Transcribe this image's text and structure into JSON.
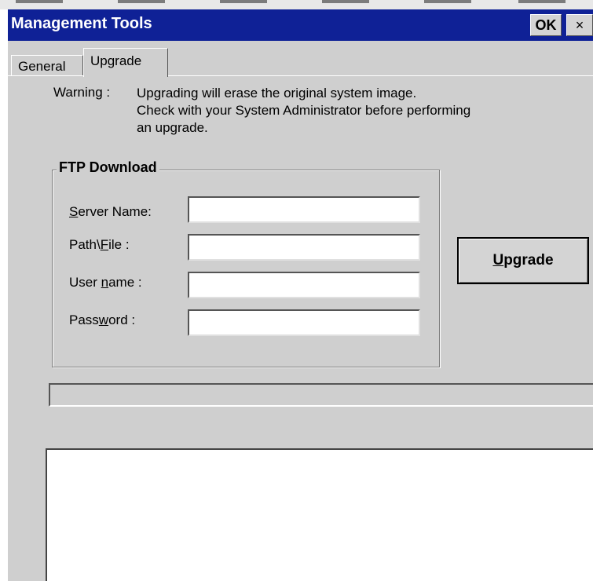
{
  "window": {
    "title": "Management Tools",
    "ok_label": "OK",
    "close_label": "×",
    "title_bar_color": "#0f2196",
    "background_color": "#cfcfcf"
  },
  "tabs": [
    {
      "label": "General",
      "active": false
    },
    {
      "label": "Upgrade",
      "active": true
    }
  ],
  "warning": {
    "label": "Warning :",
    "lines": [
      "Upgrading will erase the original system image.",
      "Check with your System Administrator before performing",
      "an upgrade."
    ]
  },
  "ftp": {
    "group_label": "FTP Download",
    "fields": [
      {
        "label_pre": "",
        "label_mnemonic": "S",
        "label_post": "erver Name:",
        "value": ""
      },
      {
        "label_pre": "Path\\",
        "label_mnemonic": "F",
        "label_post": "ile :",
        "value": ""
      },
      {
        "label_pre": "User ",
        "label_mnemonic": "n",
        "label_post": "ame :",
        "value": ""
      },
      {
        "label_pre": "Pass",
        "label_mnemonic": "w",
        "label_post": "ord :",
        "value": ""
      }
    ]
  },
  "upgrade_button": {
    "mnemonic": "U",
    "rest": "pgrade"
  },
  "progress": {
    "value": 0
  },
  "log": {
    "content": ""
  }
}
